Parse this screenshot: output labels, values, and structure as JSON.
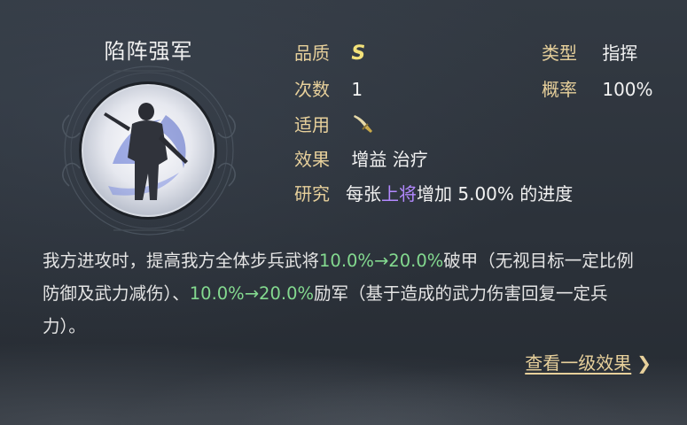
{
  "skill": {
    "name": "陷阵强军"
  },
  "attributes": {
    "quality": {
      "label": "品质",
      "value": "S"
    },
    "count": {
      "label": "次数",
      "value": "1"
    },
    "applicable": {
      "label": "适用",
      "icon": "sword-icon"
    },
    "effect": {
      "label": "效果",
      "value": "增益 治疗"
    },
    "research": {
      "label": "研究",
      "prefix": "每张",
      "highlight": "上将",
      "suffix": "增加 5.00% 的进度"
    },
    "type": {
      "label": "类型",
      "value": "指挥"
    },
    "probability": {
      "label": "概率",
      "value": "100%"
    }
  },
  "description": {
    "part1": "我方进攻时，提高我方全体步兵武将",
    "range1": "10.0%→20.0%",
    "part2": "破甲（无视目标一定比例防御及武力减伤）、",
    "range2": "10.0%→20.0%",
    "part3": "励军（基于造成的武力伤害回复一定兵力）。"
  },
  "footer": {
    "link_label": "查看一级效果",
    "chevron": "❯"
  },
  "colors": {
    "attribute_label": "#e7d09b",
    "quality": "#f3e27a",
    "highlight": "#b389ff",
    "range": "#83d98f"
  }
}
